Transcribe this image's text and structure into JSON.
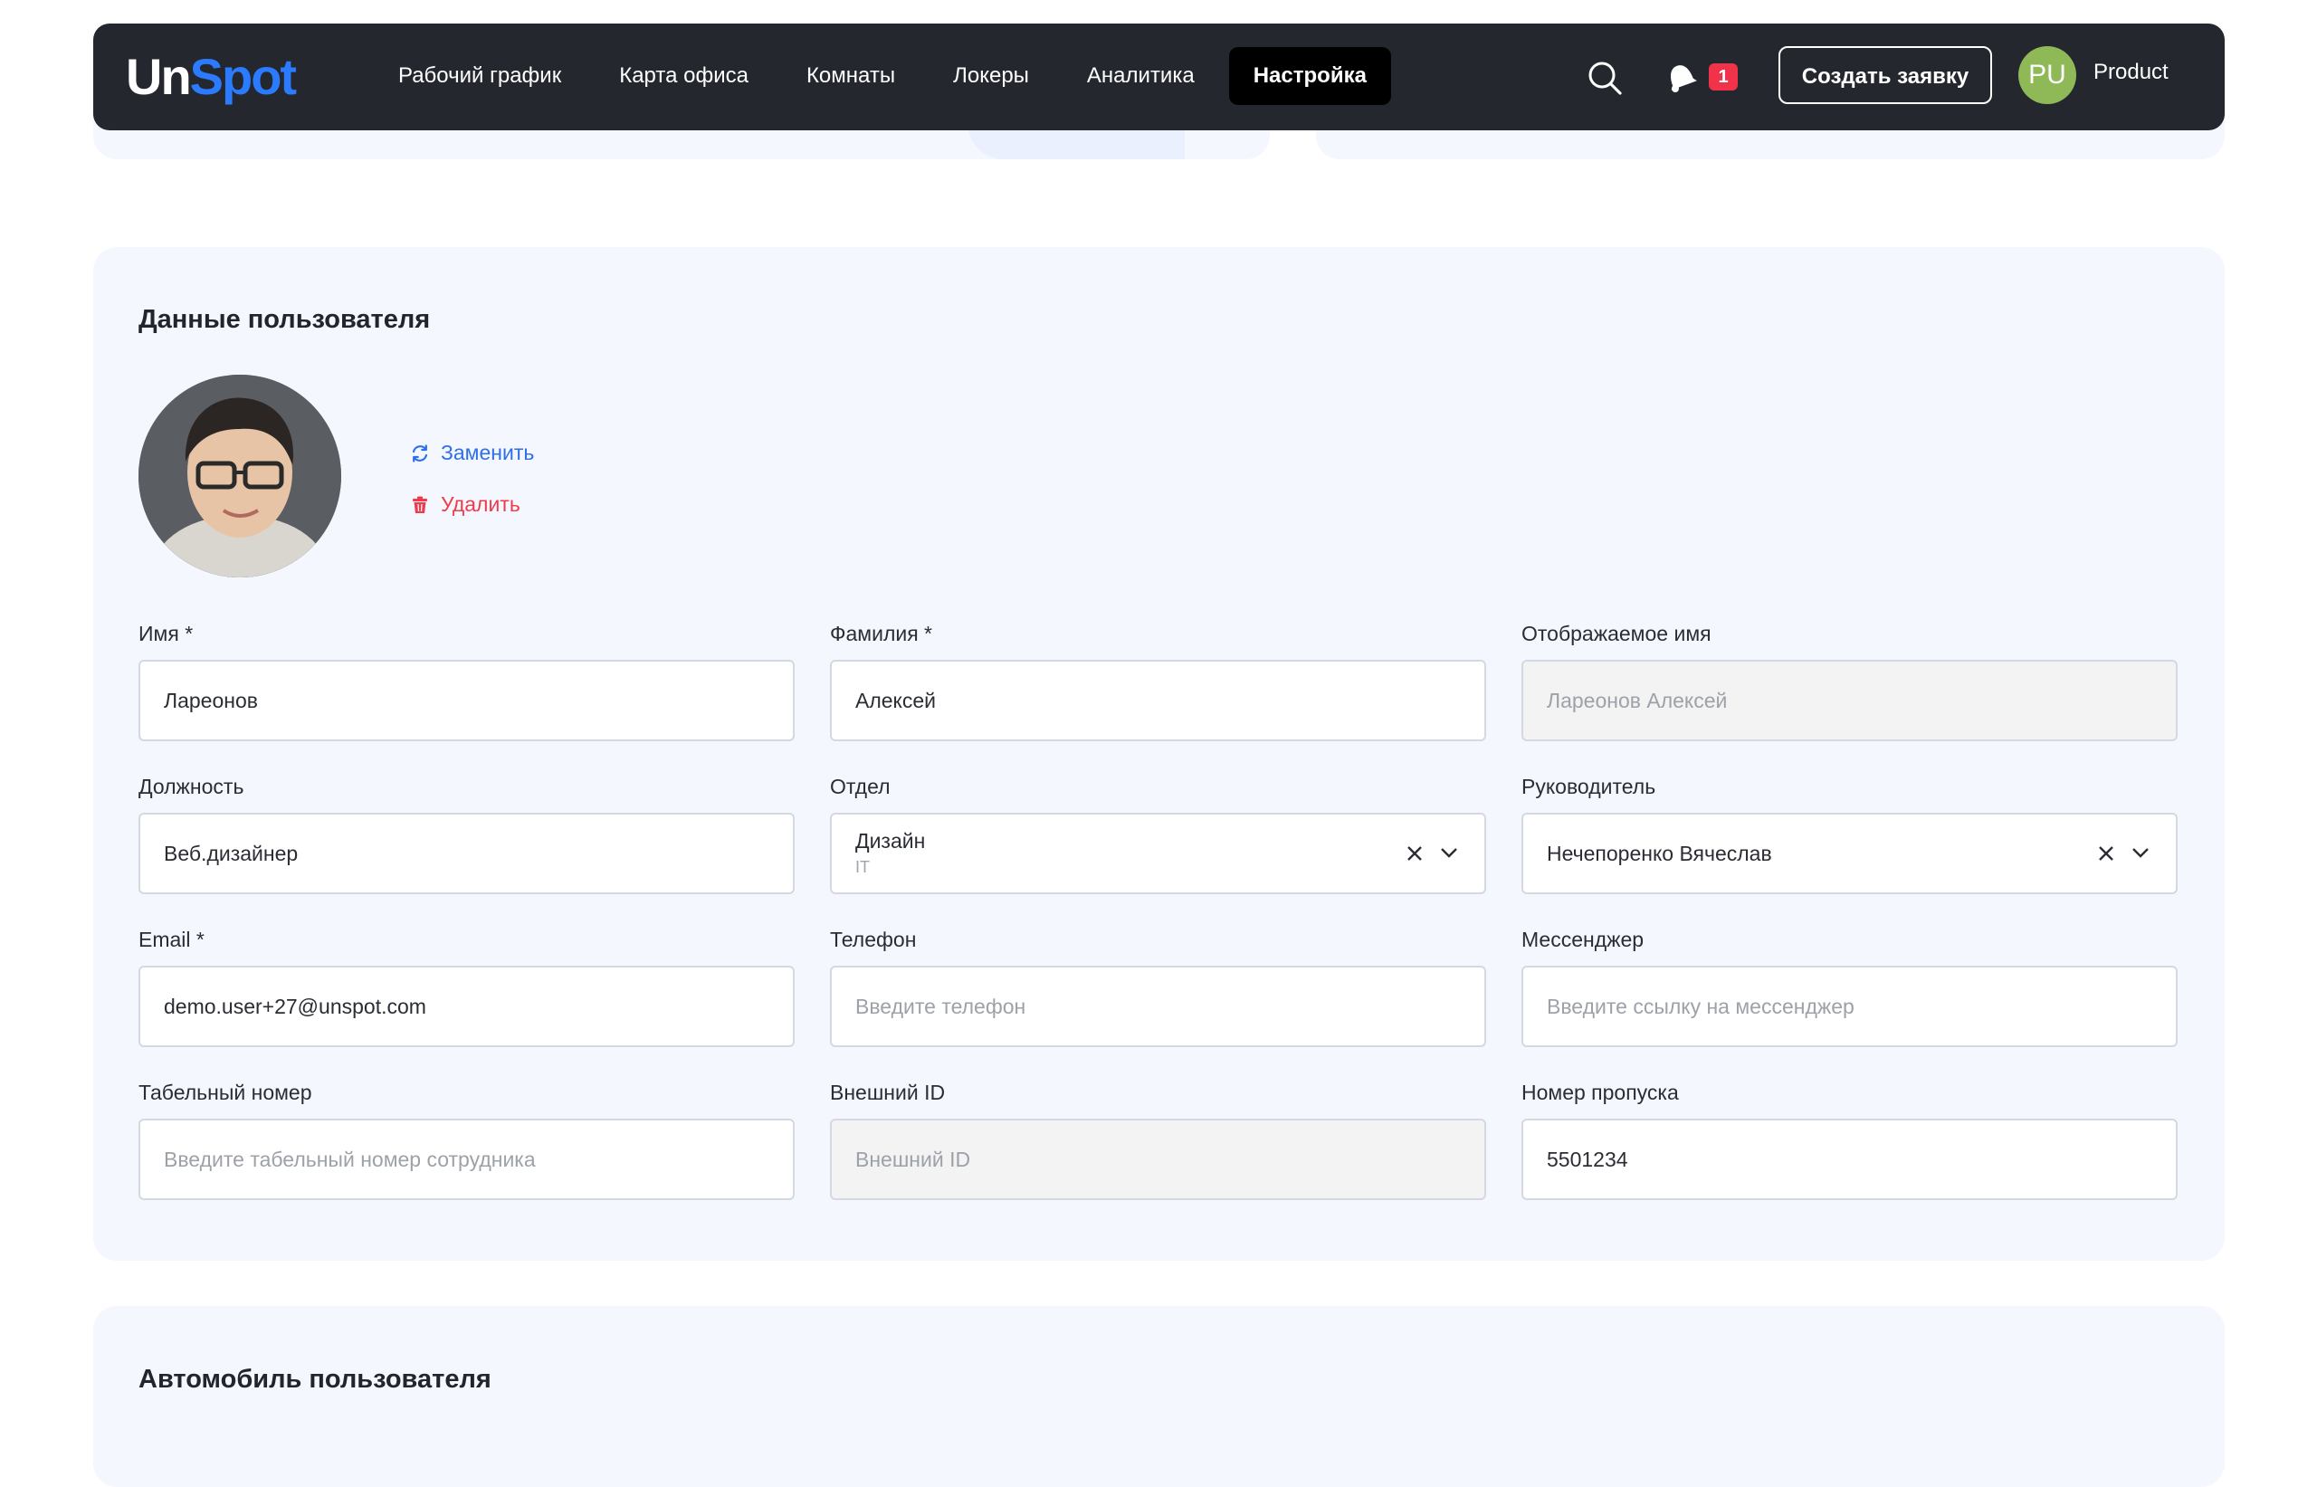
{
  "header": {
    "logo_un": "Un",
    "logo_spot": "Spot",
    "nav": [
      "Рабочий график",
      "Карта офиса",
      "Комнаты",
      "Локеры",
      "Аналитика",
      "Настройка"
    ],
    "active_nav": "Настройка",
    "notifications_count": "1",
    "create_label": "Создать заявку",
    "avatar_initials": "PU",
    "user_name": "Product"
  },
  "user_section": {
    "title": "Данные пользователя",
    "replace_label": "Заменить",
    "delete_label": "Удалить",
    "fields": {
      "first_name": {
        "label": "Имя *",
        "value": "Ларeонов"
      },
      "last_name": {
        "label": "Фамилия *",
        "value": "Алексей"
      },
      "display_name": {
        "label": "Отображаемое имя",
        "value": "Лареонов Алексей"
      },
      "position": {
        "label": "Должность",
        "value": "Веб.дизайнер"
      },
      "department": {
        "label": "Отдел",
        "value": "Дизайн",
        "sub": "IT"
      },
      "manager": {
        "label": "Руководитель",
        "value": "Нечепоренко Вячеслав"
      },
      "email": {
        "label": "Email *",
        "value": "demo.user+27@unspot.com"
      },
      "phone": {
        "label": "Телефон",
        "placeholder": "Введите телефон"
      },
      "messenger": {
        "label": "Мессенджер",
        "placeholder": "Введите ссылку на мессенджер"
      },
      "employee_number": {
        "label": "Табельный номер",
        "placeholder": "Введите табельный номер сотрудника"
      },
      "external_id": {
        "label": "Внешний ID",
        "placeholder": "Внешний ID"
      },
      "pass_number": {
        "label": "Номер пропуска",
        "value": "5501234"
      }
    }
  },
  "car_section": {
    "title": "Автомобиль пользователя"
  },
  "colors": {
    "header_bg": "#24272e",
    "accent_blue": "#2f6fe8",
    "danger_red": "#ef3b4c",
    "card_bg": "#f4f7fd"
  }
}
